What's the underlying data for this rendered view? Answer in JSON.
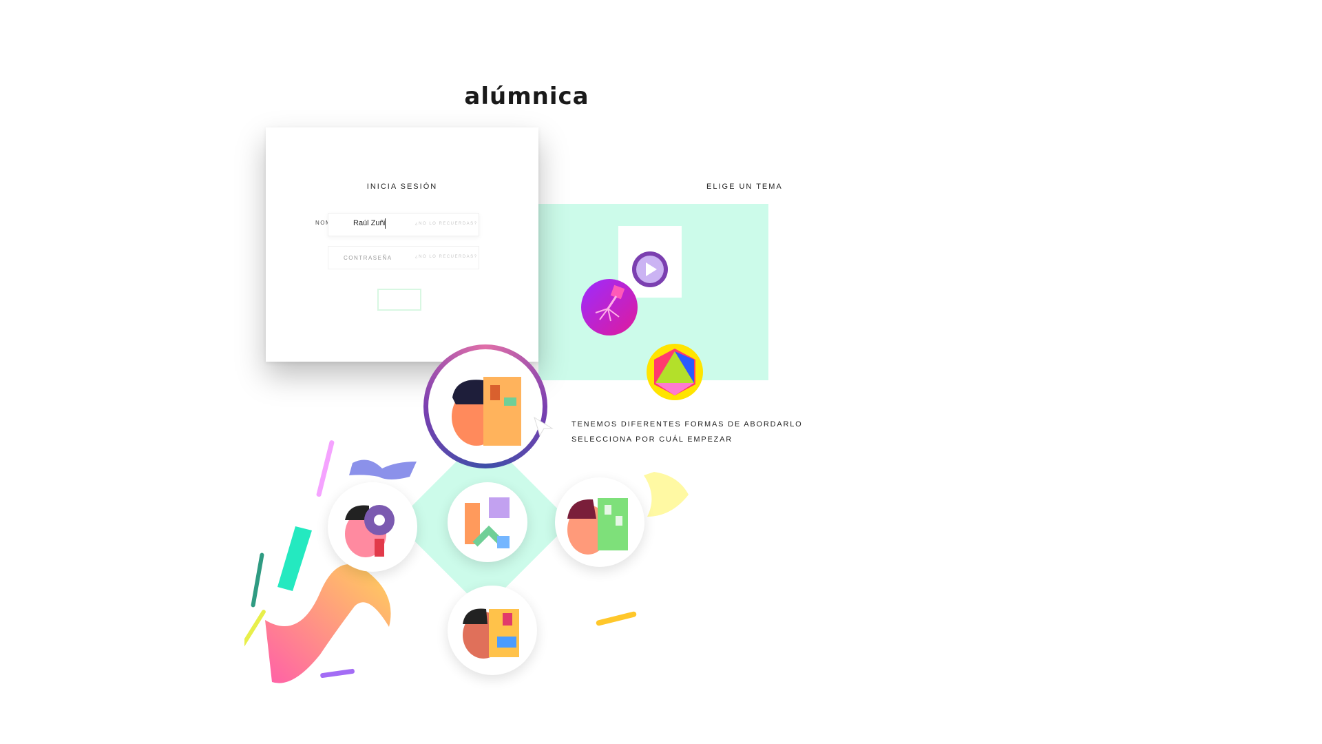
{
  "brand": {
    "name": "alúmnica",
    "accent": "#33cc33"
  },
  "login": {
    "title": "INICIA SESIÓN",
    "name_label": "NOMBRE",
    "name_value": "Raúl Zuñi",
    "name_hint": "¿NO LO RECUERDAS?",
    "password_label": "CONTRASEÑA",
    "password_hint": "¿NO LO RECUERDAS?"
  },
  "themes": {
    "label": "ELIGE UN TEMA",
    "icons": [
      "play-icon",
      "virus-molecule-icon",
      "geometric-hexagon-icon"
    ]
  },
  "paths": {
    "line1": "TENEMOS DIFERENTES FORMAS DE ABORDARLO",
    "line2": "SELECCIONA POR CUÁL EMPEZAR"
  },
  "colors": {
    "mint": "#ccfbea",
    "purple": "#7b3fb0",
    "pink": "#ff7eb3",
    "yellow": "#fde047"
  }
}
